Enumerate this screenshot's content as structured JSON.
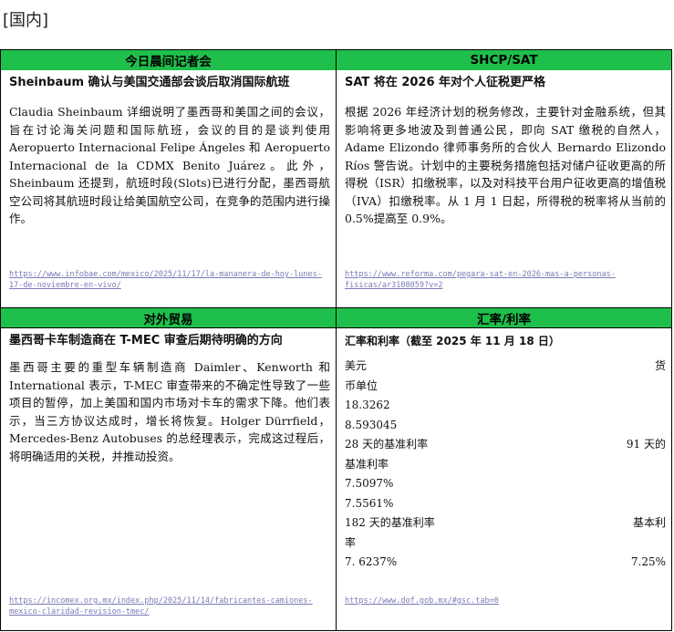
{
  "page": {
    "section_title": "[国内]"
  },
  "panels": {
    "top_left": {
      "header": "今日晨间记者会",
      "headline": "Sheinbaum 确认与美国交通部会谈后取消国际航班",
      "body": "Claudia Sheinbaum 详细说明了墨西哥和美国之间的会议，旨在讨论海关问题和国际航班，会议的目的是谈判使用 Aeropuerto Internacional Felipe Ángeles 和 Aeropuerto Internacional de la CDMX Benito Juárez。此外，Sheinbaum 还提到，航班时段(Slots)已进行分配，墨西哥航空公司将其航班时段让给美国航空公司，在竞争的范围内进行操作。",
      "link": "https://www.infobae.com/mexico/2025/11/17/la-mananera-de-hoy-lunes-17-de-noviembre-en-vivo/"
    },
    "top_right": {
      "header": "SHCP/SAT",
      "headline": "SAT 将在 2026 年对个人征税更严格",
      "body": "根据 2026 年经济计划的税务修改，主要针对金融系统，但其影响将更多地波及到普通公民，即向 SAT 缴税的自然人，Adame Elizondo 律师事务所的合伙人 Bernardo Elizondo Ríos 警告说。计划中的主要税务措施包括对储户征收更高的所得税（ISR）扣缴税率，以及对科技平台用户征收更高的增值税（IVA）扣缴税率。从 1 月 1 日起，所得税的税率将从当前的 0.5%提高至 0.9%。",
      "link": "https://www.reforma.com/pegara-sat-en-2026-mas-a-personas-fisicas/ar3108059?v=2"
    },
    "bottom_left": {
      "header": "对外贸易",
      "headline": "墨西哥卡车制造商在 T-MEC 审查后期待明确的方向",
      "body": "墨西哥主要的重型车辆制造商 Daimler、Kenworth 和 International 表示，T-MEC 审查带来的不确定性导致了一些项目的暂停，加上美国和国内市场对卡车的需求下降。他们表示，当三方协议达成时，增长将恢复。Holger Dürrfield，Mercedes-Benz Autobuses 的总经理表示，完成这过程后，将明确适用的关税，并推动投资。",
      "link": "https://incomex.org.mx/index.php/2025/11/14/fabricantes-camiones-mexico-claridad-revision-tmec/"
    },
    "bottom_right": {
      "header": "汇率/利率",
      "headline": "汇率和利率（截至 2025 年 11 月 18 日）",
      "fx": {
        "usd_label": "美元",
        "currency_unit_label_start": "货",
        "currency_unit_label_end": "币单位",
        "usd_value": "18.3262",
        "currency_unit_value": "8.593045",
        "tiie28_label": "28 天的基准利率",
        "tiie91_label_start": "91 天的",
        "tiie91_label_end": "基准利率",
        "tiie28_value": "7.5097%",
        "tiie91_value": "7.5561%",
        "tiie182_label": "182 天的基准利率",
        "base_rate_label_start": "基本利",
        "base_rate_label_end": "率",
        "tiie182_value": "7. 6237%",
        "base_rate_value": "7.25%"
      },
      "link": "https://www.dof.gob.mx/#gsc.tab=0"
    }
  }
}
